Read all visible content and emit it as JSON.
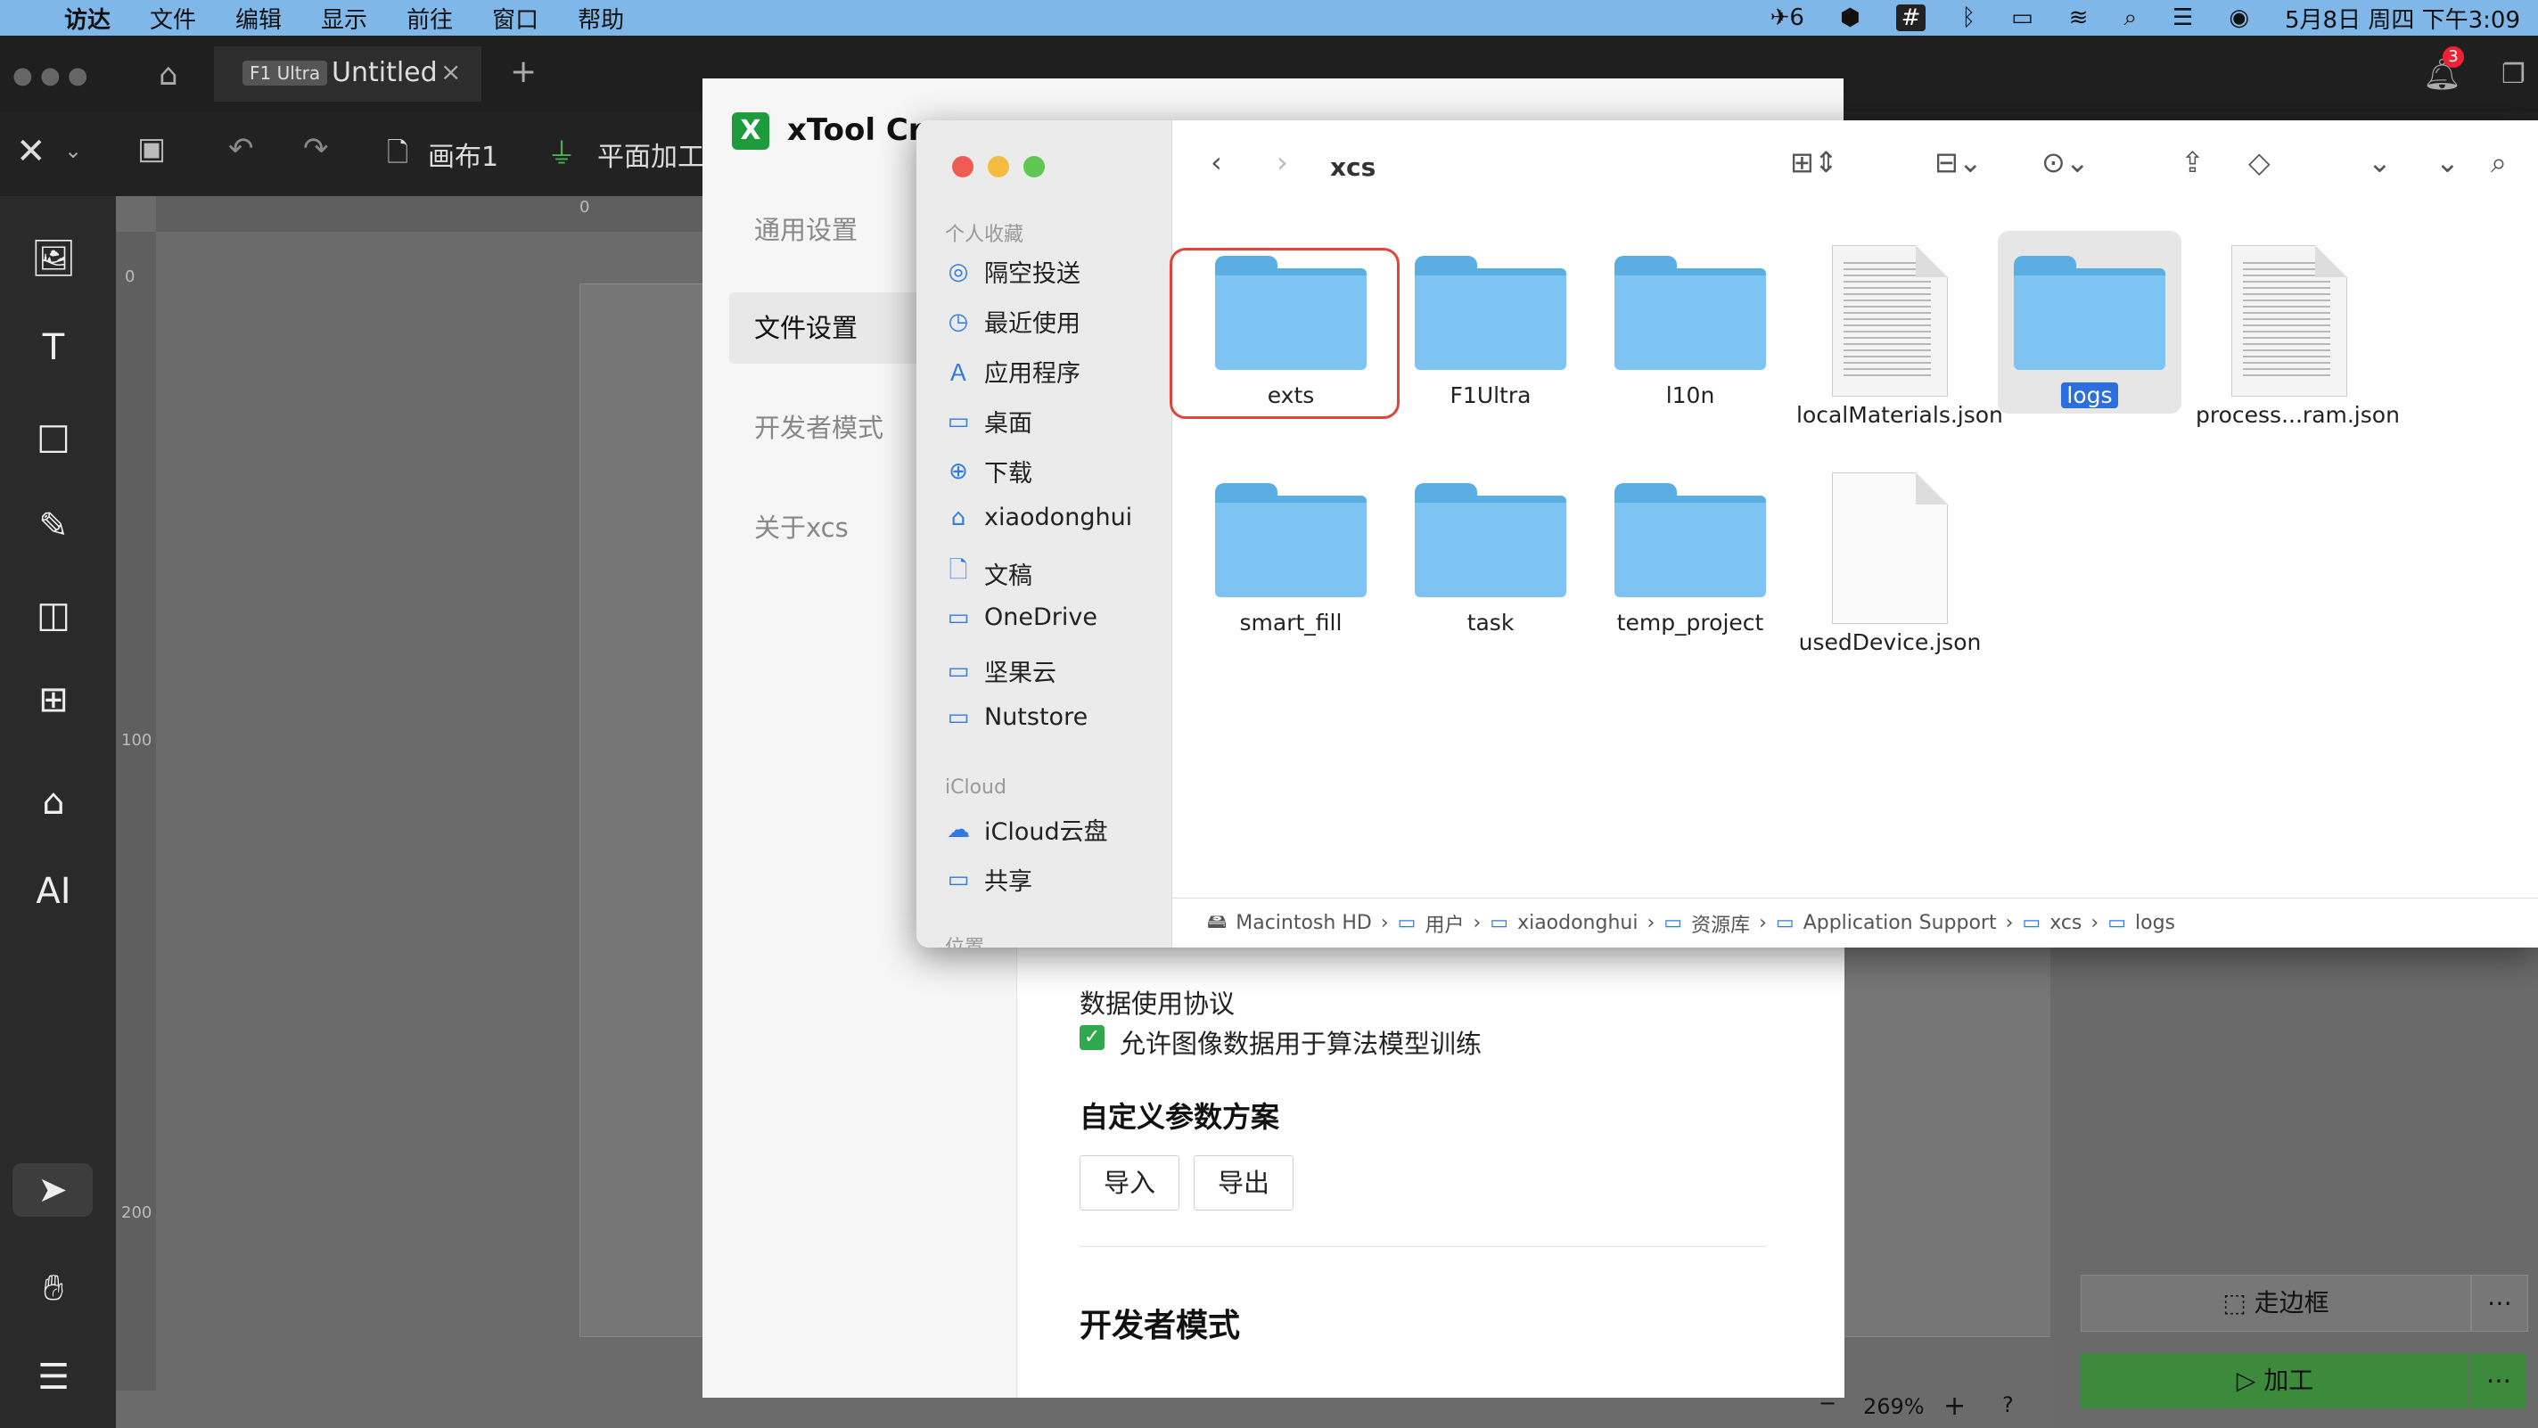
{
  "menubar": {
    "items": [
      "访达",
      "文件",
      "编辑",
      "显示",
      "前往",
      "窗口",
      "帮助"
    ],
    "badge_count": "6",
    "date_time": "5月8日 周四 下午3:09"
  },
  "app": {
    "device_chip": "F1 Ultra",
    "doc_title": "Untitled",
    "canvas_name": "画布1",
    "mode_label": "平面加工",
    "notification_count": "3",
    "zoom": "269%",
    "ruler_labels": [
      "0",
      "0",
      "100",
      "200"
    ],
    "frame_button": "走边框",
    "process_button": "加工"
  },
  "settings": {
    "title": "xTool Cre",
    "nav": [
      "通用设置",
      "文件设置",
      "开发者模式",
      "关于xcs"
    ],
    "data_policy_heading": "数据使用协议",
    "data_policy_checkbox": "允许图像数据用于算法模型训练",
    "custom_params_heading": "自定义参数方案",
    "import_label": "导入",
    "export_label": "导出",
    "dev_mode_heading": "开发者模式"
  },
  "finder": {
    "folder_title": "xcs",
    "sidebar": {
      "favorites_heading": "个人收藏",
      "favorites": [
        {
          "label": "隔空投送",
          "icon": "airdrop-icon"
        },
        {
          "label": "最近使用",
          "icon": "clock-icon"
        },
        {
          "label": "应用程序",
          "icon": "apps-icon"
        },
        {
          "label": "桌面",
          "icon": "desktop-icon"
        },
        {
          "label": "下载",
          "icon": "download-icon"
        },
        {
          "label": "xiaodonghui",
          "icon": "home-icon"
        },
        {
          "label": "文稿",
          "icon": "doc-icon"
        },
        {
          "label": "OneDrive",
          "icon": "folder-icon"
        },
        {
          "label": "坚果云",
          "icon": "folder-icon"
        },
        {
          "label": "Nutstore",
          "icon": "folder-icon"
        }
      ],
      "icloud_heading": "iCloud",
      "icloud": [
        {
          "label": "iCloud云盘",
          "icon": "cloud-icon"
        },
        {
          "label": "共享",
          "icon": "shared-folder-icon"
        }
      ],
      "locations_heading": "位置"
    },
    "files": [
      {
        "name": "exts",
        "kind": "folder"
      },
      {
        "name": "F1Ultra",
        "kind": "folder"
      },
      {
        "name": "l10n",
        "kind": "folder"
      },
      {
        "name": "localMaterials.json",
        "kind": "doc"
      },
      {
        "name": "logs",
        "kind": "folder"
      },
      {
        "name": "process...ram.json",
        "kind": "doc"
      },
      {
        "name": "smart_fill",
        "kind": "folder"
      },
      {
        "name": "task",
        "kind": "folder"
      },
      {
        "name": "temp_project",
        "kind": "folder"
      },
      {
        "name": "usedDevice.json",
        "kind": "blank-doc"
      }
    ],
    "selected_file": "logs",
    "highlighted_file": "exts",
    "highlight_color": "#e0443a",
    "path": [
      "Macintosh HD",
      "用户",
      "xiaodonghui",
      "资源库",
      "Application Support",
      "xcs",
      "logs"
    ]
  }
}
